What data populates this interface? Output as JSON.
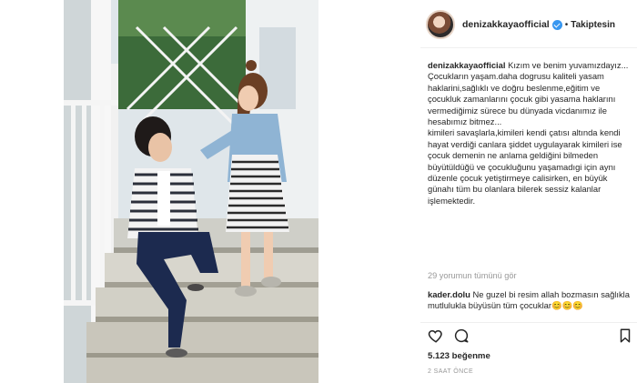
{
  "post": {
    "username": "denizakkayaofficial",
    "follow_status": "Takiptesin",
    "separator": "•",
    "caption_username": "denizakkayaofficial",
    "caption_text": "Kızım ve benim yuvamızdayız...\nÇocukların yaşam.daha dogrusu kaliteli yasam haklarini,sağlıklı ve doğru beslenme,eğitim ve çocukluk zamanlarını çocuk gibi yasama haklarını vermediğimiz sürece bu dünyada vicdanımız ile hesabımız bitmez...\nkimileri savaşlarla,kimileri kendi çatısı altında kendi hayat verdiği canlara şiddet uygulayarak kimileri ise çocuk demenin ne anlama geldiğini bilmeden büyütüldüğü ve çocukluğunu yaşamadıgi için aynı düzenle çocuk yetiştirmeye calisirken, en büyük günahı tüm bu olanlara bilerek sessiz kalanlar işlemektedir.",
    "load_comments": "29 yorumun tümünü gör",
    "comment_user": "kader.dolu",
    "comment_text": "Ne guzel bi resim allah bozmasın sağlıkla mutlulukla büyüsün tüm çocuklar😊😊😊",
    "likes": "5.123 beğenme",
    "time_ago": "2 SAAT ÖNCE"
  },
  "icons": {
    "like": "heart-icon",
    "comment": "comment-icon",
    "bookmark": "bookmark-icon"
  }
}
